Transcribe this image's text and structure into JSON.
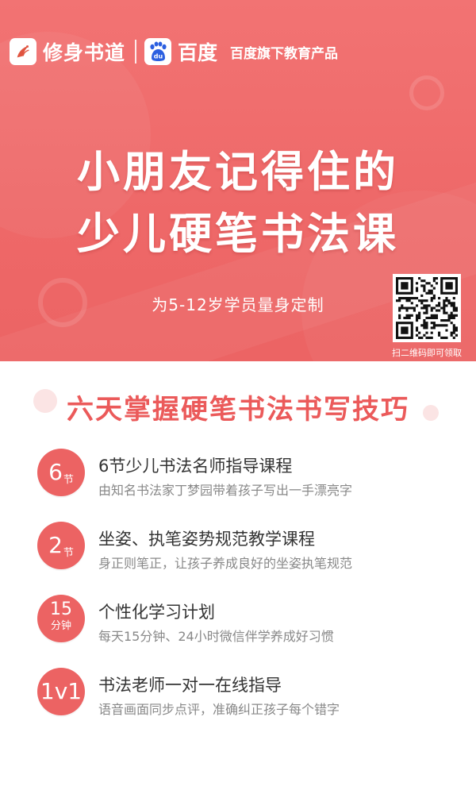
{
  "header": {
    "brand_name": "修身书道",
    "baidu_name": "百度",
    "baidu_badge": "du",
    "tagline": "百度旗下教育产品",
    "title_line1": "小朋友记得住的",
    "title_line2": "少儿硬笔书法课",
    "subtitle": "为5-12岁学员量身定制",
    "qr_caption": "扫二维码即可领取",
    "icons": [
      "crane-logo-icon",
      "baidu-paw-icon",
      "qr-code"
    ]
  },
  "section": {
    "title": "六天掌握硬笔书法书写技巧"
  },
  "features": [
    {
      "num": "6",
      "unit": "节",
      "title": "6节少儿书法名师指导课程",
      "desc": "由知名书法家丁梦园带着孩子写出一手漂亮字"
    },
    {
      "num": "2",
      "unit": "节",
      "title": "坐姿、执笔姿势规范教学课程",
      "desc": "身正则笔正，让孩子养成良好的坐姿执笔规范"
    },
    {
      "num": "15",
      "unit": "分钟",
      "title": "个性化学习计划",
      "desc": "每天15分钟、24小时微信伴学养成好习惯"
    },
    {
      "num": "1v1",
      "unit": "",
      "title": "书法老师一对一在线指导",
      "desc": "语音画面同步点评，准确纠正孩子每个错字"
    }
  ],
  "colors": {
    "header_bg": "#ee6868",
    "accent": "#eb5a5a",
    "circle": "#ec6363",
    "title_text": "#333333",
    "desc_text": "#888888"
  }
}
